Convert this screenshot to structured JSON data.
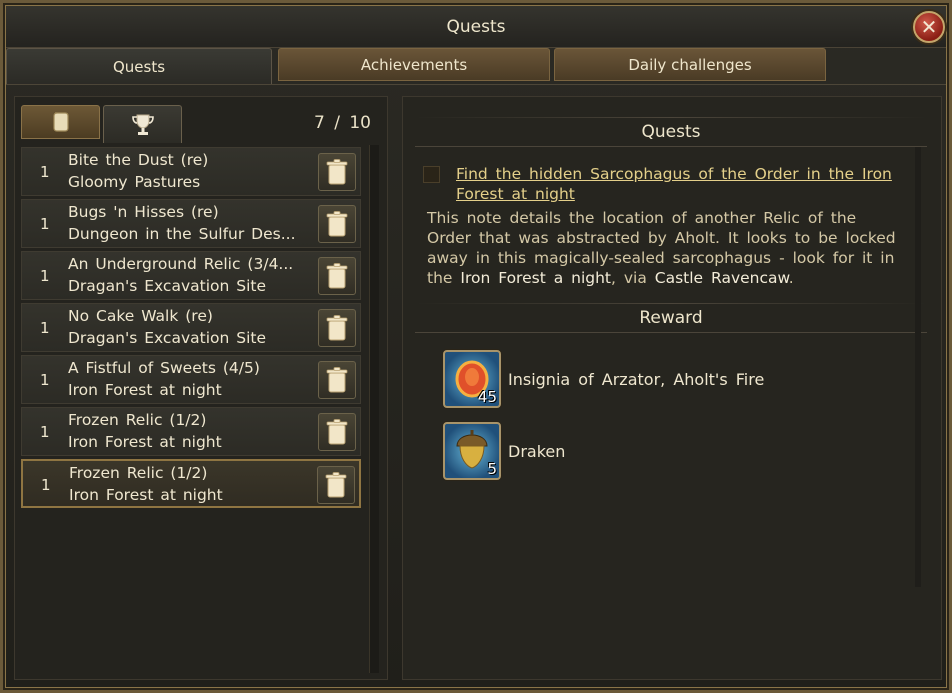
{
  "window": {
    "title": "Quests"
  },
  "main_tabs": [
    {
      "label": "Quests",
      "active": true
    },
    {
      "label": "Achievements",
      "active": false
    },
    {
      "label": "Daily  challenges",
      "active": false
    }
  ],
  "sub_tabs": [
    {
      "icon": "scroll-icon",
      "active": false
    },
    {
      "icon": "trophy-icon",
      "active": true
    }
  ],
  "counter": "7 / 10",
  "quests": [
    {
      "level": "1",
      "name": "Bite the Dust (re)",
      "location": "Gloomy Pastures"
    },
    {
      "level": "1",
      "name": "Bugs 'n Hisses (re)",
      "location": "Dungeon in the Sulfur Des..."
    },
    {
      "level": "1",
      "name": "An Underground Relic (3/4...",
      "location": "Dragan's Excavation Site"
    },
    {
      "level": "1",
      "name": "No Cake Walk (re)",
      "location": "Dragan's Excavation Site"
    },
    {
      "level": "1",
      "name": "A Fistful of Sweets (4/5)",
      "location": "Iron Forest at night"
    },
    {
      "level": "1",
      "name": "Frozen Relic (1/2)",
      "location": "Iron Forest at night"
    },
    {
      "level": "1",
      "name": "Frozen Relic (1/2)",
      "location": "Iron Forest at night",
      "selected": true
    }
  ],
  "detail": {
    "section_title": "Quests",
    "objective": "Find the hidden Sarcophagus of the Order in the Iron Forest at night",
    "description_a": "This note details the location of another Relic of the Order that was abstracted by Aholt. It looks to be locked away in this magically-sealed sarcophagus - look for it in the ",
    "description_place1": "Iron Forest a night",
    "description_b": ", via ",
    "description_place2": "Castle Ravencaw",
    "description_c": ".",
    "reward_title": "Reward",
    "rewards": [
      {
        "name": "Insignia of Arzator, Aholt's Fire",
        "count": "45",
        "icon": "insignia-icon"
      },
      {
        "name": "Draken",
        "count": "5",
        "icon": "acorn-icon"
      }
    ]
  }
}
